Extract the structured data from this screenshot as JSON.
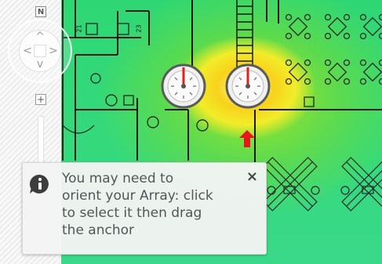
{
  "controls": {
    "north_label": "N",
    "zoom_in_label": "+",
    "pan_up": "^",
    "pan_left": "<",
    "pan_right": ">",
    "pan_down": "v"
  },
  "floorplan": {
    "room_labels": [
      "21",
      "23"
    ]
  },
  "tooltip": {
    "message": "You may need to\norient your Array: click\nto select it then drag\nthe anchor",
    "close_label": "×"
  },
  "colors": {
    "heat_hot": "#f8d21c",
    "heat_mid": "#b9e62a",
    "heat_cool": "#35d97d",
    "anchor_arrow": "#e8161b",
    "device_needle": "#d9241d"
  }
}
